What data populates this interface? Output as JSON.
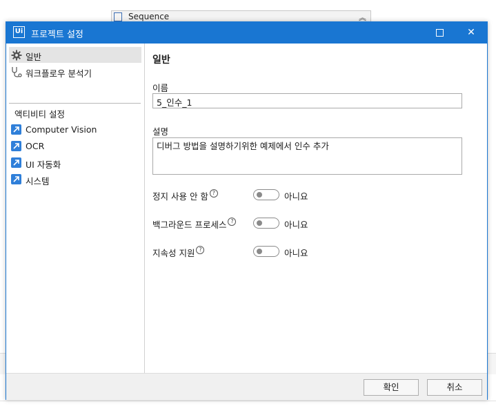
{
  "background": {
    "tab_label": "Sequence"
  },
  "dialog": {
    "logo_text": "Ui",
    "title": "프로젝트 설정",
    "maximize_glyph": "",
    "close_glyph": "✕"
  },
  "sidebar": {
    "items": [
      {
        "label": "일반",
        "icon": "gear-icon",
        "selected": true
      },
      {
        "label": "워크플로우 분석기",
        "icon": "workflow-analyzer-icon",
        "selected": false
      }
    ],
    "section_title": "액티비티 설정",
    "activity_items": [
      {
        "label": "Computer Vision",
        "icon": "activity-package-icon"
      },
      {
        "label": "OCR",
        "icon": "activity-package-icon"
      },
      {
        "label": "UI 자동화",
        "icon": "activity-package-icon"
      },
      {
        "label": "시스템",
        "icon": "activity-package-icon"
      }
    ]
  },
  "main": {
    "page_title": "일반",
    "name_label": "이름",
    "name_value": "5_인수_1",
    "description_label": "설명",
    "description_value": "디버그 방법을 설명하기위한 예제에서 인수 추가",
    "options": [
      {
        "label": "정지 사용 안 함",
        "value_text": "아니요",
        "on": false
      },
      {
        "label": "백그라운드 프로세스",
        "value_text": "아니요",
        "on": false
      },
      {
        "label": "지속성 지원",
        "value_text": "아니요",
        "on": false
      }
    ],
    "help_glyph": "?"
  },
  "footer": {
    "ok_label": "확인",
    "cancel_label": "취소"
  },
  "colors": {
    "accent": "#1976d2",
    "activity_icon": "#2f7fd9",
    "toggle_off": "#8a8a8a"
  }
}
